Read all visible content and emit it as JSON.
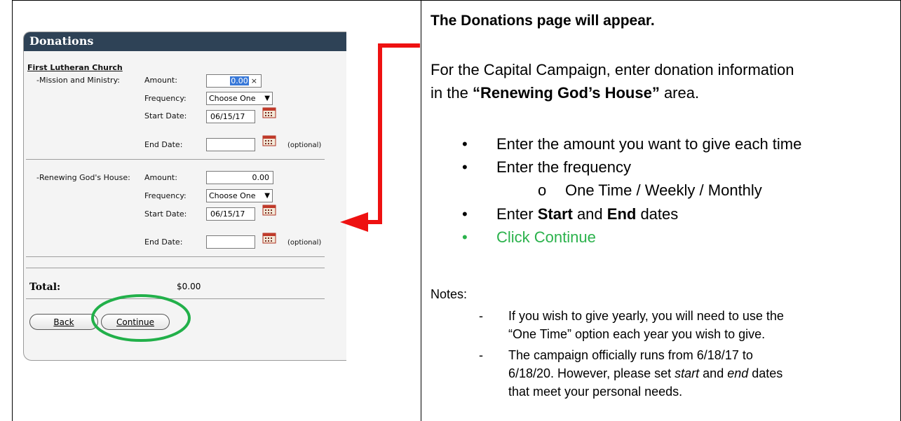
{
  "screenshot": {
    "header_title": "Donations",
    "org_name": "First Lutheran Church",
    "fund1": {
      "name": "-Mission and Ministry:",
      "amount_label": "Amount:",
      "amount_value": "0.00",
      "clear_glyph": "×",
      "frequency_label": "Frequency:",
      "frequency_value": "Choose One",
      "start_label": "Start Date:",
      "start_value": "06/15/17",
      "end_label": "End Date:",
      "end_value": "",
      "optional_text": "(optional)"
    },
    "fund2": {
      "name": "-Renewing God's House:",
      "amount_label": "Amount:",
      "amount_value": "0.00",
      "frequency_label": "Frequency:",
      "frequency_value": "Choose One",
      "start_label": "Start Date:",
      "start_value": "06/15/17",
      "end_label": "End Date:",
      "end_value": "",
      "optional_text": "(optional)"
    },
    "total_label": "Total:",
    "total_value": "$0.00",
    "back_button": "Back",
    "continue_button": "Continue"
  },
  "instructions": {
    "heading": "The Donations page will appear.",
    "para1_line1": "For the Capital Campaign, enter donation information",
    "para1_line2_pre": "in the ",
    "para1_line2_bold": "“Renewing God’s House”",
    "para1_line2_post": " area.",
    "bullet_symbol": "•",
    "sub_bullet_symbol": "o",
    "bullet1": "Enter the amount you want to give each time",
    "bullet2": "Enter the frequency",
    "sub_bullet": "One Time / Weekly / Monthly",
    "bullet4_pre": "Enter ",
    "bullet4_bold1": "Start",
    "bullet4_mid": " and ",
    "bullet4_bold2": "End",
    "bullet4_post": " dates",
    "bullet5": "Click Continue",
    "notes_label": "Notes:",
    "note_dash": "-",
    "note1_line1": "If you wish to give yearly, you will need to use the",
    "note1_line2": "“One Time” option each year you wish to give.",
    "note2_line1": "The campaign officially runs from 6/18/17 to",
    "note2_line2_pre": "6/18/20.  However, please set ",
    "note2_line2_start": "start",
    "note2_line2_mid": " and ",
    "note2_line2_end": "end",
    "note2_line2_post": " dates",
    "note2_line3": "that meet your personal needs."
  },
  "colors": {
    "header_bg": "#2e4256",
    "arrow": "#ee1111",
    "highlight_circle": "#22b04a",
    "continue_text": "#2bb24c"
  }
}
